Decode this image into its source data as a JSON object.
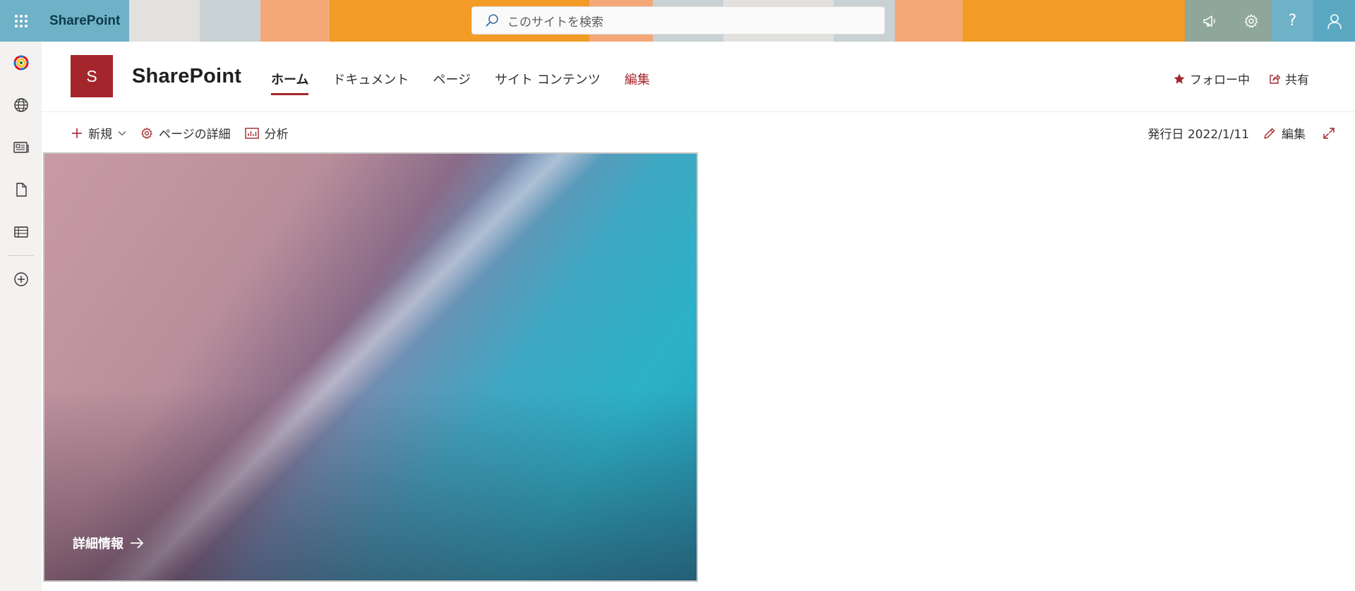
{
  "colors": {
    "suite_bar_stripes": [
      "#6fb1c6",
      "#e2e1de",
      "#c8d1d4",
      "#f4a878",
      "#f29b26",
      "#f29b26",
      "#f4a878",
      "#c8d1d4",
      "#e2e1de",
      "#c8d1d4",
      "#f4a878",
      "#f29b26",
      "#8fa69a",
      "#6fb1c6"
    ],
    "accent": "#a4262c",
    "suite_bar_brand_bg": "#6fb1c6"
  },
  "suitebar": {
    "app_name": "SharePoint",
    "search_placeholder": "このサイトを検索",
    "icons": [
      "megaphone-icon",
      "gear-icon",
      "help-icon",
      "person-icon"
    ]
  },
  "appbar": {
    "items": [
      "sharepoint-home-icon",
      "globe-icon",
      "news-icon",
      "document-icon",
      "list-icon",
      "add-icon"
    ]
  },
  "site": {
    "logo_letter": "S",
    "title": "SharePoint",
    "nav": [
      {
        "label": "ホーム",
        "active": true
      },
      {
        "label": "ドキュメント"
      },
      {
        "label": "ページ"
      },
      {
        "label": "サイト コンテンツ"
      },
      {
        "label": "編集"
      }
    ],
    "follow_label": "フォロー中",
    "share_label": "共有"
  },
  "commandbar": {
    "new_label": "新規",
    "page_details_label": "ページの詳細",
    "analytics_label": "分析",
    "published": "発行日 2022/1/11",
    "edit_label": "編集"
  },
  "hero": {
    "cta_label": "詳細情報"
  }
}
